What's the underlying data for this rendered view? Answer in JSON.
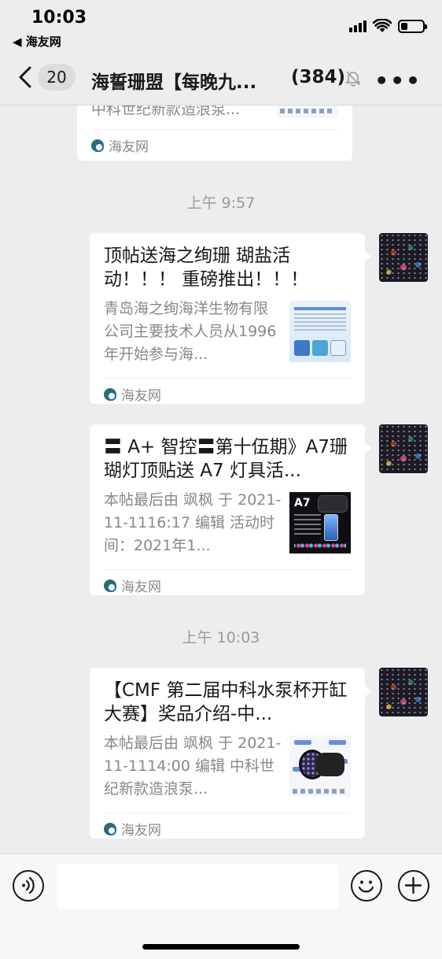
{
  "status_bar": {
    "time": "10:03",
    "back_app": "◀ 海友网",
    "battery_level_percent": 30
  },
  "nav": {
    "unread_badge": "20",
    "title": "海誓珊盟【每晚九...",
    "member_count": "(384)",
    "more_label": "•••"
  },
  "messages": [
    {
      "type": "partial_card",
      "desc": "中科世纪新款造浪泵...",
      "source": "海友网"
    },
    {
      "type": "time",
      "text": "上午 9:57"
    },
    {
      "type": "card",
      "title": "顶帖送海之绚珊 瑚盐活动！！！ 重磅推出！！！",
      "desc": "青岛海之绚海洋生物有限公司主要技术人员从1996年开始参与海...",
      "source": "海友网",
      "thumb": "reef-salt-product-thumbnail"
    },
    {
      "type": "card",
      "title": "〓 A+ 智控〓第十伍期》A7珊 瑚灯顶贴送 A7 灯具活...",
      "desc": "本帖最后由 飒枫 于 2021-11-1116:17 编辑 活动时间：2021年1...",
      "source": "海友网",
      "thumb": "a7-lamp-thumbnail",
      "thumb_label": "A7"
    },
    {
      "type": "time",
      "text": "上午 10:03"
    },
    {
      "type": "card",
      "title": "【CMF 第二届中科水泵杯开缸大赛】奖品介绍-中...",
      "desc": "本帖最后由 飒枫 于 2021-11-1114:00 编辑 中科世纪新款造浪泵...",
      "source": "海友网",
      "thumb": "wave-pump-thumbnail"
    }
  ],
  "input_bar": {
    "voice_icon": "voice-icon",
    "emoji_icon": "emoji-icon",
    "plus_icon": "plus-icon",
    "text_value": ""
  }
}
